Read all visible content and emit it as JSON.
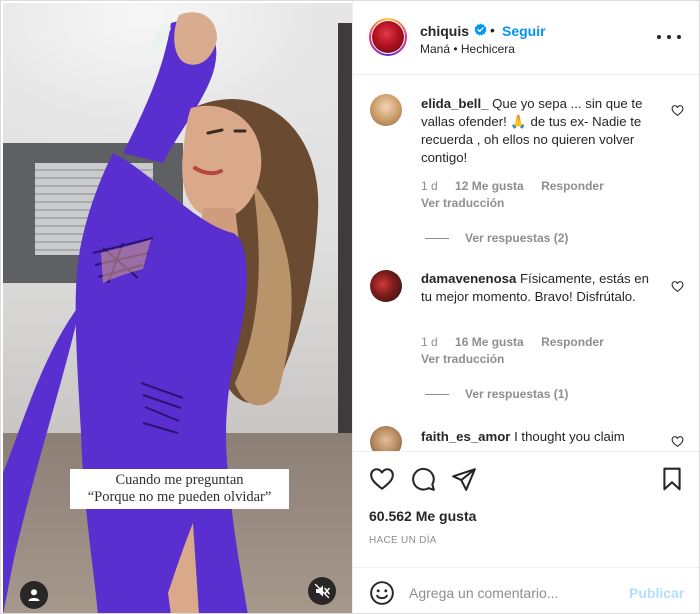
{
  "post": {
    "username": "chiquis",
    "follow_label": "Seguir",
    "separator": "•",
    "audio": "Maná • Hechicera"
  },
  "media": {
    "caption_line1": "Cuando me preguntan",
    "caption_line2": "“Porque no me pueden olvidar”",
    "dress_color": "#5a2fd0"
  },
  "comments": [
    {
      "user": "elida_bell_",
      "text": "Que yo sepa ... sin que te vallas ofender! 🙏 de tus ex- Nadie te recuerda , oh ellos no quieren volver contigo!",
      "age": "1 d",
      "likes": "12 Me gusta",
      "reply": "Responder",
      "translate": "Ver traducción",
      "replies": "Ver respuestas (2)"
    },
    {
      "user": "damavenenosa",
      "text": "Físicamente, estás en tu mejor momento. Bravo! Disfrútalo.",
      "age": "1 d",
      "likes": "16 Me gusta",
      "reply": "Responder",
      "translate": "Ver traducción",
      "replies": "Ver respuestas (1)"
    },
    {
      "user": "faith_es_amor",
      "text": "I thought you claim"
    }
  ],
  "footer": {
    "likes": "60.562 Me gusta",
    "time": "HACE UN DÍA",
    "comment_placeholder": "Agrega un comentario...",
    "publish_label": "Publicar"
  },
  "colors": {
    "accent": "#0095f6",
    "publish_disabled": "#b2dffc",
    "muted": "#8e8e8e"
  }
}
